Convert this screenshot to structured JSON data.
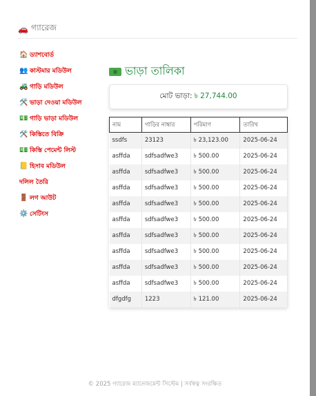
{
  "brand": {
    "icon": "car-icon",
    "label": "গ্যারেজ"
  },
  "sidebar": {
    "items": [
      {
        "icon": "🏠",
        "label": "ড্যাশবোর্ড"
      },
      {
        "icon": "👥",
        "label": "কাস্টমার মডিউল"
      },
      {
        "icon": "🚜",
        "label": "গাড়ি মডিউল"
      },
      {
        "icon": "🛠️",
        "label": "ভাড়া দেওয়া মডিউল"
      },
      {
        "icon": "💵",
        "label": "গাড়ি ভাড়া মডিউল"
      },
      {
        "icon": "🛠️",
        "label": "কিস্তিতে বিক্রি"
      },
      {
        "icon": "💵",
        "label": "কিস্তি পেমেন্ট লিস্ট"
      },
      {
        "icon": "📒",
        "label": "হিসাব মডিউল"
      },
      {
        "icon": "",
        "label": "দলিল তৈরি"
      },
      {
        "icon": "🚪",
        "label": "লগ আউট"
      },
      {
        "icon": "⚙️",
        "label": "সেটিংস"
      }
    ]
  },
  "content": {
    "title": "ভাড়া তালিকা",
    "total_label": "মোট ভাড়া:",
    "total_amount": "৳ 27,744.00"
  },
  "table": {
    "headers": [
      "নাম",
      "গাড়ির নাম্বার",
      "পরিমাণ",
      "তারিখ"
    ],
    "rows": [
      [
        "ssdfs",
        "23123",
        "৳ 23,123.00",
        "2025-06-24"
      ],
      [
        "asffda",
        "sdfsadfwe3",
        "৳ 500.00",
        "2025-06-24"
      ],
      [
        "asffda",
        "sdfsadfwe3",
        "৳ 500.00",
        "2025-06-24"
      ],
      [
        "asffda",
        "sdfsadfwe3",
        "৳ 500.00",
        "2025-06-24"
      ],
      [
        "asffda",
        "sdfsadfwe3",
        "৳ 500.00",
        "2025-06-24"
      ],
      [
        "asffda",
        "sdfsadfwe3",
        "৳ 500.00",
        "2025-06-24"
      ],
      [
        "asffda",
        "sdfsadfwe3",
        "৳ 500.00",
        "2025-06-24"
      ],
      [
        "asffda",
        "sdfsadfwe3",
        "৳ 500.00",
        "2025-06-24"
      ],
      [
        "asffda",
        "sdfsadfwe3",
        "৳ 500.00",
        "2025-06-24"
      ],
      [
        "asffda",
        "sdfsadfwe3",
        "৳ 500.00",
        "2025-06-24"
      ],
      [
        "dfgdfg",
        "1223",
        "৳ 121.00",
        "2025-06-24"
      ]
    ]
  },
  "footer": {
    "text": "© 2025 গ্যারেজ ম্যানেজমেন্ট সিস্টেম | সর্বস্বত্ব সংরক্ষিত"
  },
  "colors": {
    "nav": "#e00000",
    "accent_green": "#1e8a3c"
  }
}
